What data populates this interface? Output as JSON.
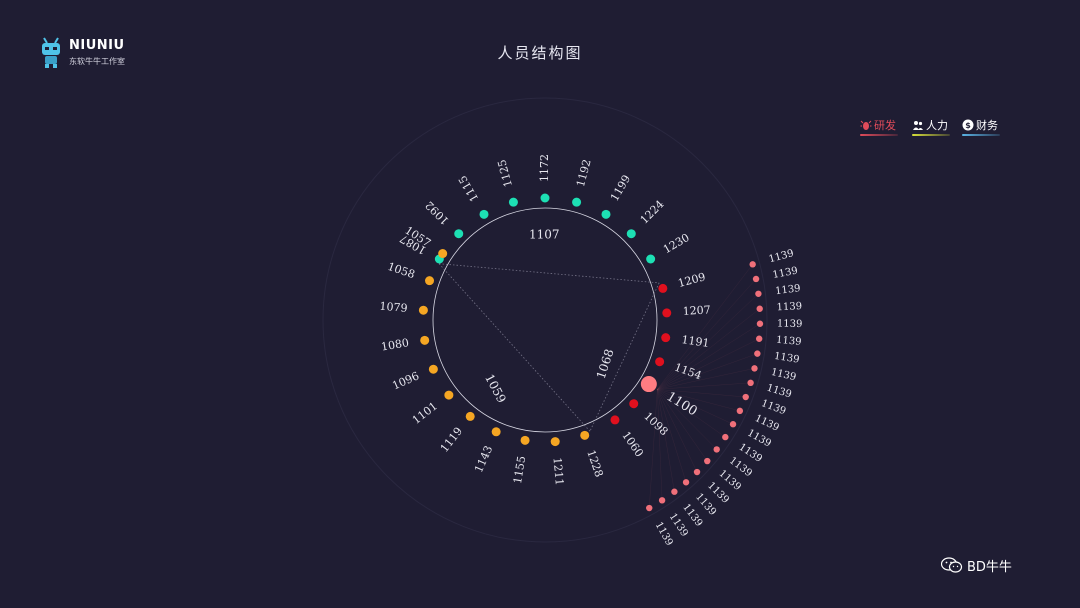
{
  "header": {
    "logo_name": "NIUNIU",
    "logo_sub": "东软牛牛工作室",
    "title": "人员结构图"
  },
  "legend": [
    {
      "label": "研发",
      "color": "#e14b5a",
      "icon": "bug-icon"
    },
    {
      "label": "人力",
      "color": "#d8e03a",
      "icon": "people-icon"
    },
    {
      "label": "财务",
      "color": "#5ab4e6",
      "icon": "coin-icon"
    }
  ],
  "watermark": {
    "text": "BD牛牛",
    "icon": "wechat-icon"
  },
  "chart_data": {
    "type": "chord-radial",
    "title": "人员结构图",
    "groups": [
      {
        "name": "1107",
        "color": "#1de0b4",
        "members": [
          "1087",
          "1092",
          "1115",
          "1125",
          "1172",
          "1192",
          "1199",
          "1224",
          "1230"
        ]
      },
      {
        "name": "1068",
        "color": "#e0101e",
        "members": [
          "1209",
          "1207",
          "1191",
          "1154",
          "1100",
          "1098",
          "1060"
        ]
      },
      {
        "name": "1059",
        "color": "#f5a623",
        "members": [
          "1228",
          "1211",
          "1155",
          "1143",
          "1119",
          "1101",
          "1096",
          "1080",
          "1079",
          "1058",
          "1057"
        ]
      }
    ],
    "highlighted": "1100",
    "outer_branch": {
      "parent": "1100",
      "color": "#f0707a",
      "values": [
        "1139",
        "1139",
        "1139",
        "1139",
        "1139",
        "1139",
        "1139",
        "1139",
        "1139",
        "1139",
        "1139",
        "1139",
        "1139",
        "1139",
        "1139",
        "1139",
        "1139",
        "1139",
        "1139",
        "1139"
      ]
    }
  }
}
